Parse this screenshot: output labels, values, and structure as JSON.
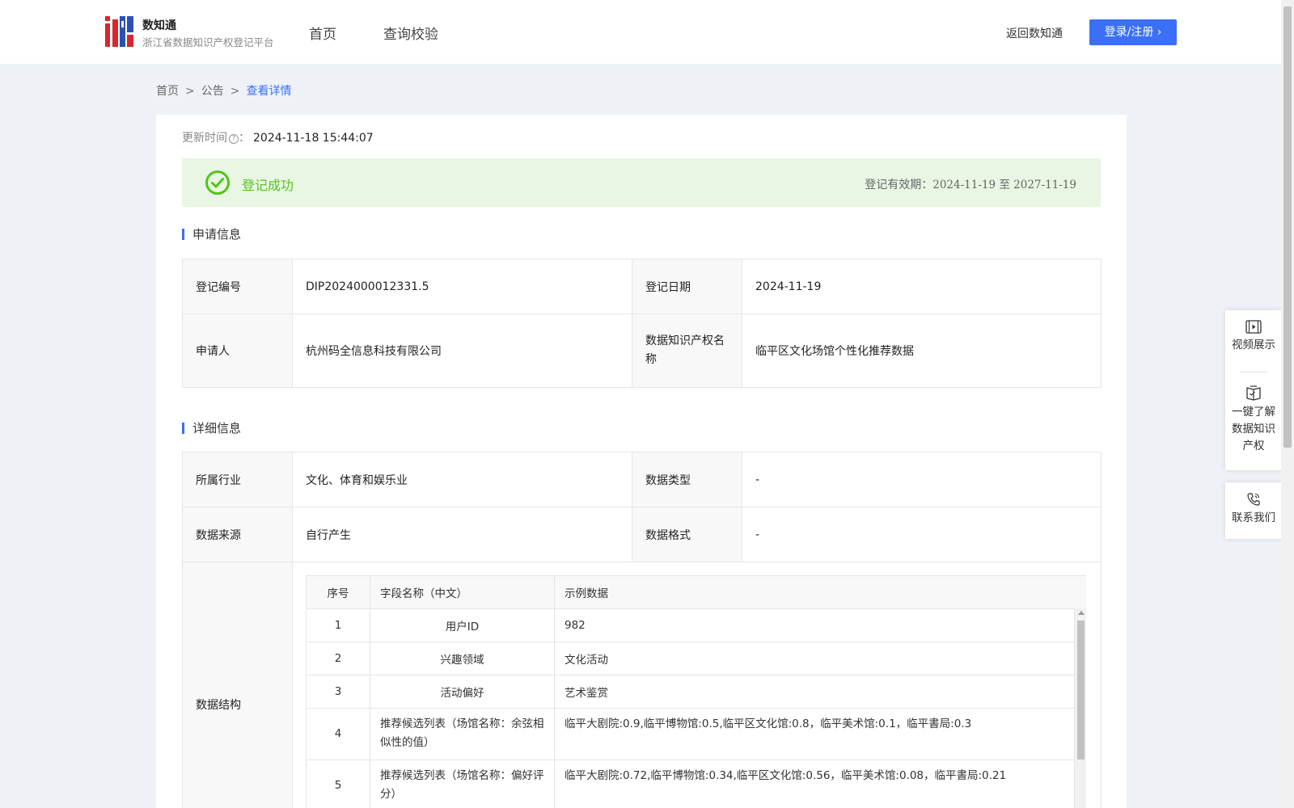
{
  "header": {
    "brand_name": "数知通",
    "brand_sub": "浙江省数据知识产权登记平台",
    "nav": [
      "首页",
      "查询校验"
    ],
    "back_link": "返回数知通",
    "login_label": "登录/注册 ›"
  },
  "breadcrumb": [
    "首页",
    "公告",
    "查看详情"
  ],
  "detail": {
    "update_label": "更新时间",
    "update_colon": "：",
    "update_time": "2024-11-18 15:44:07",
    "status_text": "登记成功",
    "validity_label": "登记有效期：",
    "validity_dates": "2024-11-19 至 2027-11-19",
    "status_color": "#52c41a"
  },
  "section_apply": {
    "title": "申请信息",
    "rows": [
      [
        {
          "label": "登记编号",
          "value": "DIP2024000012331.5"
        },
        {
          "label": "登记日期",
          "value": "2024-11-19"
        }
      ],
      [
        {
          "label": "申请人",
          "value": "杭州码全信息科技有限公司"
        },
        {
          "label": "数据知识产权名称",
          "value": "临平区文化场馆个性化推荐数据"
        }
      ]
    ]
  },
  "section_detail": {
    "title": "详细信息",
    "rows": [
      [
        {
          "label": "所属行业",
          "value": "文化、体育和娱乐业"
        },
        {
          "label": "数据类型",
          "value": "-"
        }
      ],
      [
        {
          "label": "数据来源",
          "value": "自行产生"
        },
        {
          "label": "数据格式",
          "value": "-"
        }
      ]
    ],
    "structure_label": "数据结构",
    "structure_headers": [
      "序号",
      "字段名称（中文）",
      "示例数据"
    ],
    "structure_rows": [
      {
        "no": "1",
        "field": "用户ID",
        "example": "982"
      },
      {
        "no": "2",
        "field": "兴趣领域",
        "example": "文化活动"
      },
      {
        "no": "3",
        "field": "活动偏好",
        "example": "艺术鉴赏"
      },
      {
        "no": "4",
        "field": "推荐候选列表（场馆名称：余弦相似性的值）",
        "example": "临平大剧院:0.9,临平博物馆:0.5,临平区文化馆:0.8，临平美术馆:0.1，临平書局:0.3"
      },
      {
        "no": "5",
        "field": "推荐候选列表（场馆名称：偏好评分）",
        "example": "临平大剧院:0.72,临平博物馆:0.34,临平区文化馆:0.56，临平美术馆:0.08，临平書局:0.21"
      }
    ]
  },
  "float_panel": {
    "video": "视频展示",
    "learn_lines": [
      "一键了解",
      "数据知识",
      "产权"
    ],
    "contact": "联系我们"
  },
  "colors": {
    "accent": "#3b6ff5",
    "success_bg": "#e8f6e3",
    "page_bg": "#eef2f6"
  }
}
